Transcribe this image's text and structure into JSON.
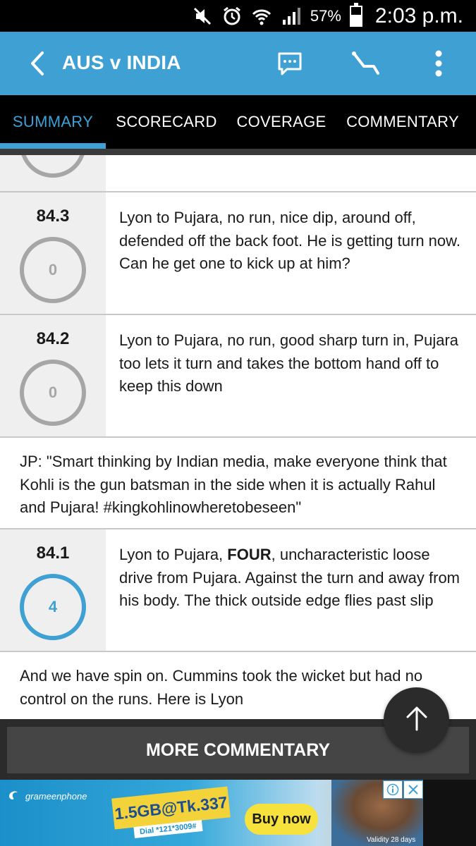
{
  "status_bar": {
    "battery": "57%",
    "battery_level": 0.57,
    "time": "2:03 p.m.",
    "icons": [
      "mute-icon",
      "alarm-icon",
      "wifi-icon",
      "signal-icon",
      "battery-icon"
    ]
  },
  "app_bar": {
    "title": "AUS v INDIA",
    "accent_color": "#3fa0d4",
    "icons": [
      "back-arrow-icon",
      "chat-icon",
      "scorecard-icon",
      "overflow-menu-icon"
    ]
  },
  "tabs": [
    {
      "label": "SUMMARY",
      "active": true
    },
    {
      "label": "SCORECARD",
      "active": false
    },
    {
      "label": "COVERAGE",
      "active": false
    },
    {
      "label": "COMMENTARY",
      "active": false
    }
  ],
  "feed": {
    "items": [
      {
        "over": "84.3",
        "runs": "0",
        "text": "Lyon to Pujara, no run, nice dip, around off, defended off the back foot. He is getting turn now. Can he get one to kick up at him?"
      },
      {
        "over": "84.2",
        "runs": "0",
        "text": "Lyon to Pujara, no run, good sharp turn in, Pujara too lets it turn and takes the bottom hand off to keep this down"
      },
      {
        "note": "JP: \"Smart thinking by Indian media, make everyone think that Kohli is the gun batsman in the side when it is actually Rahul and Pujara! #kingkohlinowheretobeseen\""
      },
      {
        "over": "84.1",
        "runs": "4",
        "text_before": "Lyon to Pujara, ",
        "text_bold": "FOUR",
        "text_after": ", uncharacteristic loose drive from Pujara. Against the turn and away from his body. The thick outside edge flies past slip"
      },
      {
        "note": "And we have spin on. Cummins took the wicket but had no control on the runs. Here is Lyon"
      }
    ]
  },
  "more_button": {
    "label": "MORE COMMENTARY"
  },
  "fab": {
    "icon": "arrow-up-icon"
  },
  "ad": {
    "brand": "grameenphone",
    "offer": "1.5GB@Tk.337",
    "dial": "Dial *121*3009#",
    "cta": "Buy now",
    "validity": "Validity 28 days"
  }
}
